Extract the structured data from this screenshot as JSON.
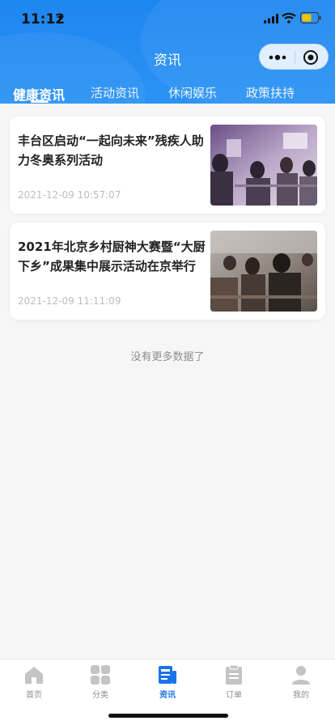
{
  "status": {
    "time": "11:12",
    "icons": [
      "location-arrow-icon",
      "signal-icon",
      "wifi-icon",
      "battery-icon"
    ]
  },
  "nav": {
    "title": "资讯",
    "capsule_icons": [
      "more-dots-icon",
      "close-target-icon"
    ]
  },
  "tabs": [
    {
      "label": "健康资讯",
      "active": true
    },
    {
      "label": "活动资讯",
      "active": false
    },
    {
      "label": "休闲娱乐",
      "active": false
    },
    {
      "label": "政策扶持",
      "active": false
    }
  ],
  "articles": [
    {
      "title": "丰台区启动“一起向未来”残疾人助力冬奥系列活动",
      "time": "2021-12-09 10:57:07"
    },
    {
      "title": "2021年北京乡村厨神大赛暨“大厨下乡”成果集中展示活动在京举行",
      "time": "2021-12-09 11:11:09"
    }
  ],
  "list_footer": "没有更多数据了",
  "tabbar": [
    {
      "label": "首页",
      "icon": "home-icon",
      "active": false
    },
    {
      "label": "分类",
      "icon": "grid-icon",
      "active": false
    },
    {
      "label": "资讯",
      "icon": "news-icon",
      "active": true
    },
    {
      "label": "订单",
      "icon": "clipboard-icon",
      "active": false
    },
    {
      "label": "我的",
      "icon": "user-icon",
      "active": false
    }
  ],
  "colors": {
    "header_blue": "#1e86f0",
    "active_tab": "#1a73e8",
    "inactive_tab": "#c4c4c4"
  }
}
